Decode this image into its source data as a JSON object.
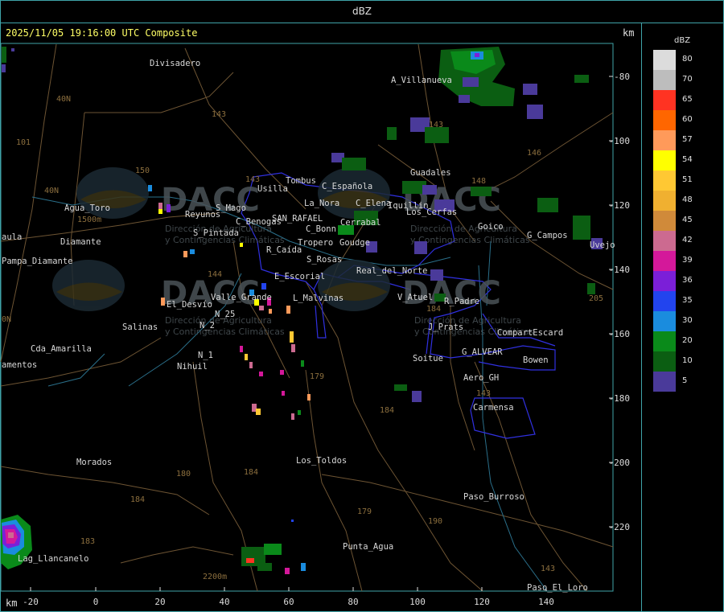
{
  "top_bar": {
    "title": "dBZ"
  },
  "header": {
    "timestamp": "2025/11/05 19:16:00 UTC Composite",
    "unit_top": "km",
    "unit_bottom": "km"
  },
  "x_axis": {
    "ticks": [
      "-20",
      "0",
      "20",
      "40",
      "60",
      "80",
      "100",
      "120",
      "140"
    ]
  },
  "y_axis": {
    "ticks": [
      "-80",
      "-100",
      "-120",
      "-140",
      "-160",
      "-180",
      "-200",
      "-220"
    ]
  },
  "legend": {
    "title": "dBZ",
    "items": [
      {
        "value": "80",
        "color": "#dcdcdc"
      },
      {
        "value": "70",
        "color": "#bdbdbd"
      },
      {
        "value": "65",
        "color": "#ff3322"
      },
      {
        "value": "60",
        "color": "#ff6600"
      },
      {
        "value": "57",
        "color": "#ff9a5a"
      },
      {
        "value": "54",
        "color": "#ffff00"
      },
      {
        "value": "51",
        "color": "#ffc833"
      },
      {
        "value": "48",
        "color": "#f0b030"
      },
      {
        "value": "45",
        "color": "#d08a3a"
      },
      {
        "value": "42",
        "color": "#cc6a90"
      },
      {
        "value": "39",
        "color": "#d4189a"
      },
      {
        "value": "36",
        "color": "#7b1fd8"
      },
      {
        "value": "35",
        "color": "#2244ee"
      },
      {
        "value": "30",
        "color": "#1a8cde"
      },
      {
        "value": "20",
        "color": "#0a8a1a"
      },
      {
        "value": "10",
        "color": "#0b5e12"
      },
      {
        "value": "5",
        "color": "#4a3a9a"
      }
    ]
  },
  "places": [
    "Divisadero",
    "A_Villanueva",
    "Guadales",
    "Tombus",
    "Usilla",
    "C_Española",
    "La_Nora",
    "C_Elena",
    "Iquillin",
    "Los_Cerfas",
    "Goico",
    "G_Campos",
    "Uvejo",
    "Agua_Toro",
    "Reyunos",
    "S_Mago",
    "C_Benogas",
    "SAN_RAFAEL",
    "Cerrabal",
    "C_Bonn",
    "S_Pintada",
    "Tropero",
    "Goudge",
    "R_Caída",
    "S_Rosas",
    "Real_del_Norte",
    "E_Escorial",
    "V_Atuel",
    "R_Padre",
    "El_Desvío",
    "Valle_Grande",
    "L_Malvinas",
    "Salinas",
    "N_25",
    "N_2",
    "J_Prats",
    "CompartEscard",
    "N_1",
    "Cda_Amarilla",
    "G_ALVEAR",
    "Bowen",
    "Soitue",
    "Nihuil",
    "Aero_GH",
    "amentos",
    "Carmensa",
    "aula",
    "Pampa_Diamante",
    "Morados",
    "Los_Toldos",
    "Paso_Burroso",
    "Punta_Agua",
    "Lag_Llancanelo",
    "Paso_El_Loro",
    "Diamante",
    "Agua_Toro"
  ],
  "road_labels": [
    "143",
    "150",
    "101",
    "40N",
    "40N",
    "146",
    "148",
    "143",
    "144",
    "179",
    "184",
    "180",
    "184",
    "184",
    "183",
    "190",
    "179",
    "143",
    "143",
    "205",
    "1500m",
    "2200m",
    "184",
    "143",
    "0N"
  ],
  "watermark": {
    "brand": "DACC",
    "line1": "Dirección de Agricultura",
    "line2": "y Contingencias Climáticas",
    "url": "http://www.contingencias.mendoza.gov.ar"
  }
}
